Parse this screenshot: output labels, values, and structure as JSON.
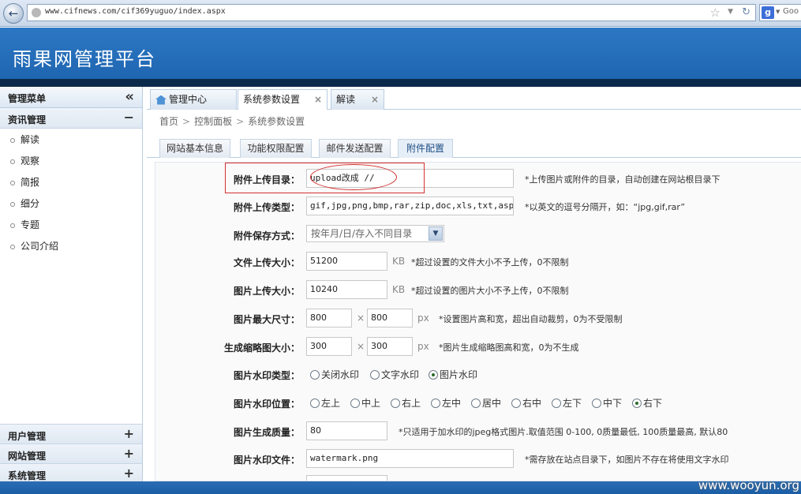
{
  "browser": {
    "url": "www.cifnews.com/cif369yuguo/index.aspx",
    "search_text": "Goo"
  },
  "header": {
    "title": "雨果网管理平台"
  },
  "sidebar": {
    "title": "管理菜单",
    "collapse_icon": "«",
    "open_section": {
      "label": "资讯管理",
      "toggle": "−"
    },
    "items": [
      "解读",
      "观察",
      "简报",
      "细分",
      "专题",
      "公司介绍"
    ],
    "bottom_sections": [
      {
        "label": "用户管理",
        "toggle": "+"
      },
      {
        "label": "网站管理",
        "toggle": "+"
      },
      {
        "label": "系统管理",
        "toggle": "+"
      }
    ]
  },
  "tabs": [
    {
      "label": "管理中心"
    },
    {
      "label": "系统参数设置",
      "close": "×"
    },
    {
      "label": "解读",
      "close": "×"
    }
  ],
  "breadcrumb": [
    "首页",
    "控制面板",
    "系统参数设置"
  ],
  "breadcrumb_sep": ">",
  "subtabs": [
    "网站基本信息",
    "功能权限配置",
    "邮件发送配置",
    "附件配置"
  ],
  "form": {
    "upload_dir": {
      "label": "附件上传目录：",
      "value": "upload改成 //",
      "hint": "*上传图片或附件的目录，自动创建在网站根目录下"
    },
    "upload_types": {
      "label": "附件上传类型：",
      "value": "gif,jpg,png,bmp,rar,zip,doc,xls,txt,aspx,as",
      "hint": "*以英文的逗号分隔开，如：“jpg,gif,rar”"
    },
    "save_mode": {
      "label": "附件保存方式：",
      "value": "按年月/日/存入不同目录"
    },
    "file_size": {
      "label": "文件上传大小：",
      "value": "51200",
      "unit": "KB",
      "hint": "*超过设置的文件大小不予上传，0不限制"
    },
    "img_size": {
      "label": "图片上传大小：",
      "value": "10240",
      "unit": "KB",
      "hint": "*超过设置的图片大小不予上传，0不限制"
    },
    "img_max": {
      "label": "图片最大尺寸：",
      "w": "800",
      "h": "800",
      "times": "×",
      "unit": "px",
      "hint": "*设置图片高和宽，超出自动裁剪，0为不受限制"
    },
    "thumb": {
      "label": "生成缩略图大小：",
      "w": "300",
      "h": "300",
      "times": "×",
      "unit": "px",
      "hint": "*图片生成缩略图高和宽，0为不生成"
    },
    "wm_type": {
      "label": "图片水印类型：",
      "options": [
        "关闭水印",
        "文字水印",
        "图片水印"
      ],
      "selected": "图片水印"
    },
    "wm_pos": {
      "label": "图片水印位置：",
      "options": [
        "左上",
        "中上",
        "右上",
        "左中",
        "居中",
        "右中",
        "左下",
        "中下",
        "右下"
      ],
      "selected": "右下"
    },
    "quality": {
      "label": "图片生成质量：",
      "value": "80",
      "hint": "*只适用于加水印的jpeg格式图片.取值范围 0-100, 0质量最低, 100质量最高, 默认80"
    },
    "wm_file": {
      "label": "图片水印文件：",
      "value": "watermark.png",
      "hint": "*需存放在站点目录下，如图片不存在将使用文字水印"
    }
  },
  "watermark": "www.wooyun.org",
  "colors": {
    "header": "#2571bd",
    "dark_band": "#0b2a4b",
    "annotation": "#d43030"
  }
}
